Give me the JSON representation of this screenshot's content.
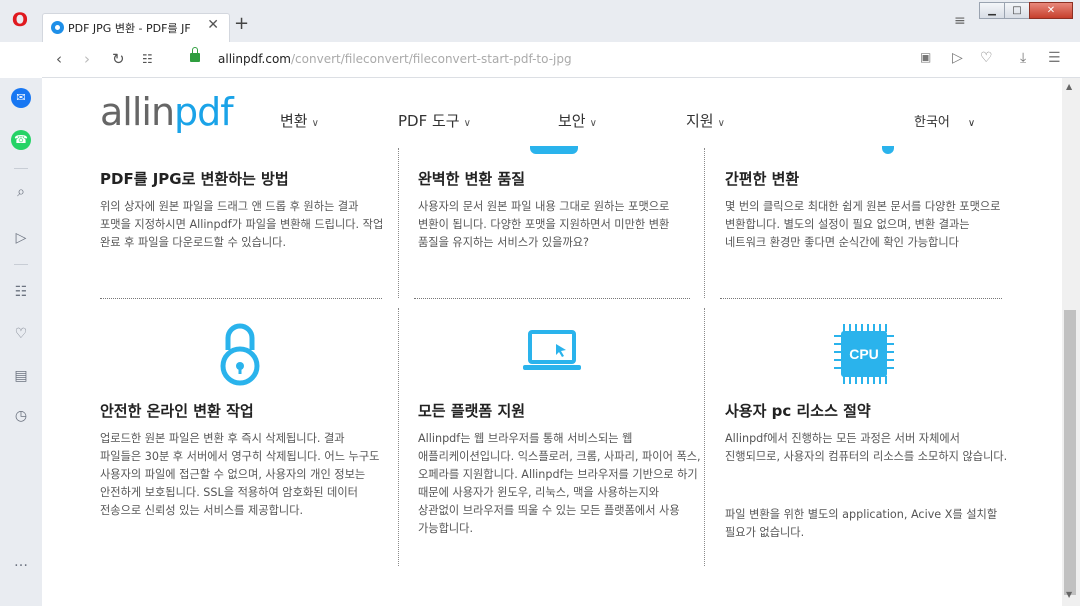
{
  "browser": {
    "tab_title": "PDF JPG 변환 - PDF를 JF",
    "tab_close": "✕",
    "new_tab": "+",
    "url_host": "allinpdf.com",
    "url_path": "/convert/fileconvert/fileconvert-start-pdf-to-jpg",
    "window_buttons": {
      "minimize": "▁",
      "maximize": "□",
      "close": "✕"
    }
  },
  "site": {
    "logo_prefix": "allin",
    "logo_suffix": "pdf",
    "nav": [
      {
        "label": "변환"
      },
      {
        "label": "PDF 도구"
      },
      {
        "label": "보안"
      },
      {
        "label": "지원"
      }
    ],
    "language": "한국어"
  },
  "features": [
    {
      "title": "PDF를 JPG로 변환하는 방법",
      "text": "위의 상자에 원본 파일을 드래그 앤 드롭 후 원하는 결과 포맷을 지정하시면 Allinpdf가 파일을 변환해 드립니다. 작업 완료 후 파일을 다운로드할 수 있습니다."
    },
    {
      "title": "완벽한 변환 품질",
      "text": "사용자의 문서 원본 파일 내용 그대로 원하는 포맷으로 변환이 됩니다. 다양한 포맷을 지원하면서 미만한 변환 품질을 유지하는 서비스가 있을까요?"
    },
    {
      "title": "간편한 변환",
      "text": "몇 번의 클릭으로 최대한 쉽게 원본 문서를 다양한 포맷으로 변환합니다. 별도의 설정이 필요 없으며, 변환 결과는 네트워크 환경만 좋다면 순식간에 확인 가능합니다"
    },
    {
      "title": "안전한 온라인 변환 작업",
      "text": "업로드한 원본 파일은 변환 후 즉시 삭제됩니다. 결과 파일들은 30분 후 서버에서 영구히 삭제됩니다. 어느 누구도 사용자의 파일에 접근할 수 없으며, 사용자의 개인 정보는 안전하게 보호됩니다. SSL을 적용하여 암호화된 데이터 전송으로 신뢰성 있는 서비스를 제공합니다."
    },
    {
      "title": "모든 플랫폼 지원",
      "text": "Allinpdf는 웹 브라우저를 통해 서비스되는 웹 애플리케이션입니다. 익스플로러, 크롬, 사파리, 파이어 폭스, 오페라를 지원합니다. Allinpdf는 브라우저를 기반으로 하기 때문에 사용자가 윈도우, 리눅스, 맥을 사용하는지와 상관없이 브라우저를 띄울 수 있는 모든 플랫폼에서 사용 가능합니다."
    },
    {
      "title": "사용자 pc 리소스 절약",
      "text": "Allinpdf에서 진행하는 모든 과정은 서버 자체에서 진행되므로, 사용자의 컴퓨터의 리소스를 소모하지 않습니다.",
      "text2": "파일 변환을 위한 별도의 application, Acive X를 설치할 필요가 없습니다."
    }
  ],
  "cpu_label": "CPU",
  "colors": {
    "accent": "#2ab3ec",
    "opera": "#e0191f"
  }
}
